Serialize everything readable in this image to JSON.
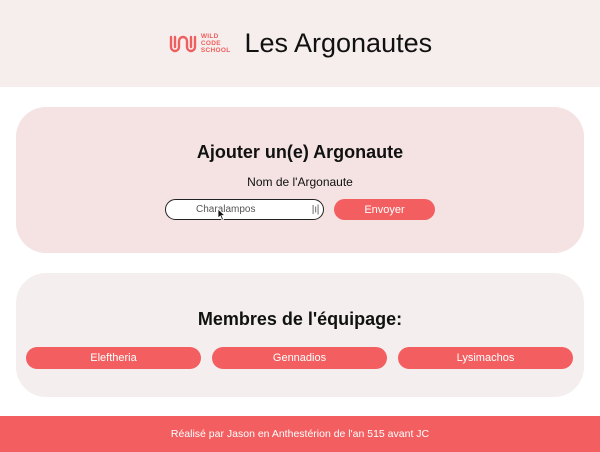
{
  "header": {
    "logo_lines": [
      "WILD",
      "CODE",
      "SCHOOL"
    ],
    "title": "Les Argonautes"
  },
  "form": {
    "title": "Ajouter un(e) Argonaute",
    "label": "Nom de l'Argonaute",
    "input_value": "Charalampos",
    "submit_label": "Envoyer"
  },
  "crew": {
    "title": "Membres de l'équipage:",
    "members": [
      "Eleftheria",
      "Gennadios",
      "Lysimachos"
    ]
  },
  "footer": {
    "text": "Réalisé par Jason en Anthestérion de l'an 515 avant JC"
  },
  "colors": {
    "accent": "#f35f60",
    "header_bg": "#f5eeec",
    "form_card_bg": "#f4e3e2",
    "crew_card_bg": "#f4efee"
  },
  "icons": [
    "wild-code-school-logo",
    "password-manager-icon",
    "pointer-cursor-icon"
  ]
}
